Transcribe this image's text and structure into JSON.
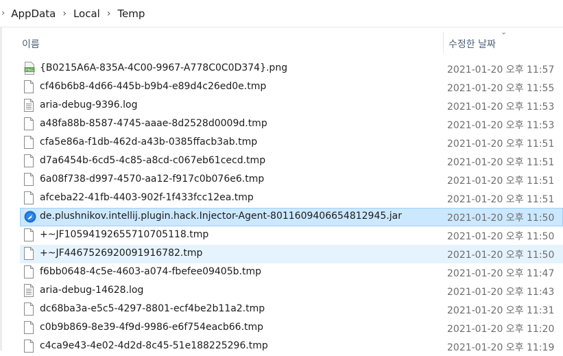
{
  "breadcrumb": {
    "items": [
      "AppData",
      "Local",
      "Temp"
    ]
  },
  "columns": {
    "name": "이름",
    "date_modified": "수정한 날짜"
  },
  "files": [
    {
      "name": "{B0215A6A-835A-4C00-9967-A778C0C0D374}.png",
      "date": "2021-01-20 오후 11:57",
      "type": "png"
    },
    {
      "name": "cf46b6b8-4d66-445b-b9b4-e89d4c26ed0e.tmp",
      "date": "2021-01-20 오후 11:55",
      "type": "blank"
    },
    {
      "name": "aria-debug-9396.log",
      "date": "2021-01-20 오후 11:53",
      "type": "text"
    },
    {
      "name": "a48fa88b-8587-4745-aaae-8d2528d0009d.tmp",
      "date": "2021-01-20 오후 11:53",
      "type": "blank"
    },
    {
      "name": "cfa5e86a-f1db-462d-a43b-0385ffacb3ab.tmp",
      "date": "2021-01-20 오후 11:51",
      "type": "blank"
    },
    {
      "name": "d7a6454b-6cd5-4c85-a8cd-c067eb61cecd.tmp",
      "date": "2021-01-20 오후 11:51",
      "type": "blank"
    },
    {
      "name": "6a08f738-d997-4570-aa12-f917c0b076e6.tmp",
      "date": "2021-01-20 오후 11:51",
      "type": "blank"
    },
    {
      "name": "afceba22-41fb-4403-902f-1f433fcc12ea.tmp",
      "date": "2021-01-20 오후 11:51",
      "type": "blank"
    },
    {
      "name": "de.plushnikov.intellij.plugin.hack.Injector-Agent-8011609406654812945.jar",
      "date": "2021-01-20 오후 11:50",
      "type": "jar",
      "state": "selected"
    },
    {
      "name": "+~JF10594192655710705118.tmp",
      "date": "2021-01-20 오후 11:50",
      "type": "blank"
    },
    {
      "name": "+~JF4467526920091916782.tmp",
      "date": "2021-01-20 오후 11:50",
      "type": "blank",
      "state": "hover"
    },
    {
      "name": "f6bb0648-4c5e-4603-a074-fbefee09405b.tmp",
      "date": "2021-01-20 오후 11:47",
      "type": "blank"
    },
    {
      "name": "aria-debug-14628.log",
      "date": "2021-01-20 오후 11:43",
      "type": "text"
    },
    {
      "name": "dc68ba3a-e5c5-4297-8801-ecf4be2b11a2.tmp",
      "date": "2021-01-20 오후 11:31",
      "type": "blank"
    },
    {
      "name": "c0b9b869-8e39-4f9d-9986-e6f754eacb66.tmp",
      "date": "2021-01-20 오후 11:20",
      "type": "blank"
    },
    {
      "name": "c4ca9e43-4e02-4d2d-8c45-51e188225296.tmp",
      "date": "2021-01-20 오후 11:19",
      "type": "blank"
    }
  ],
  "colors": {
    "selected_bg": "#cce8ff",
    "hover_bg": "#e5f3ff",
    "header_text": "#4c607a"
  }
}
